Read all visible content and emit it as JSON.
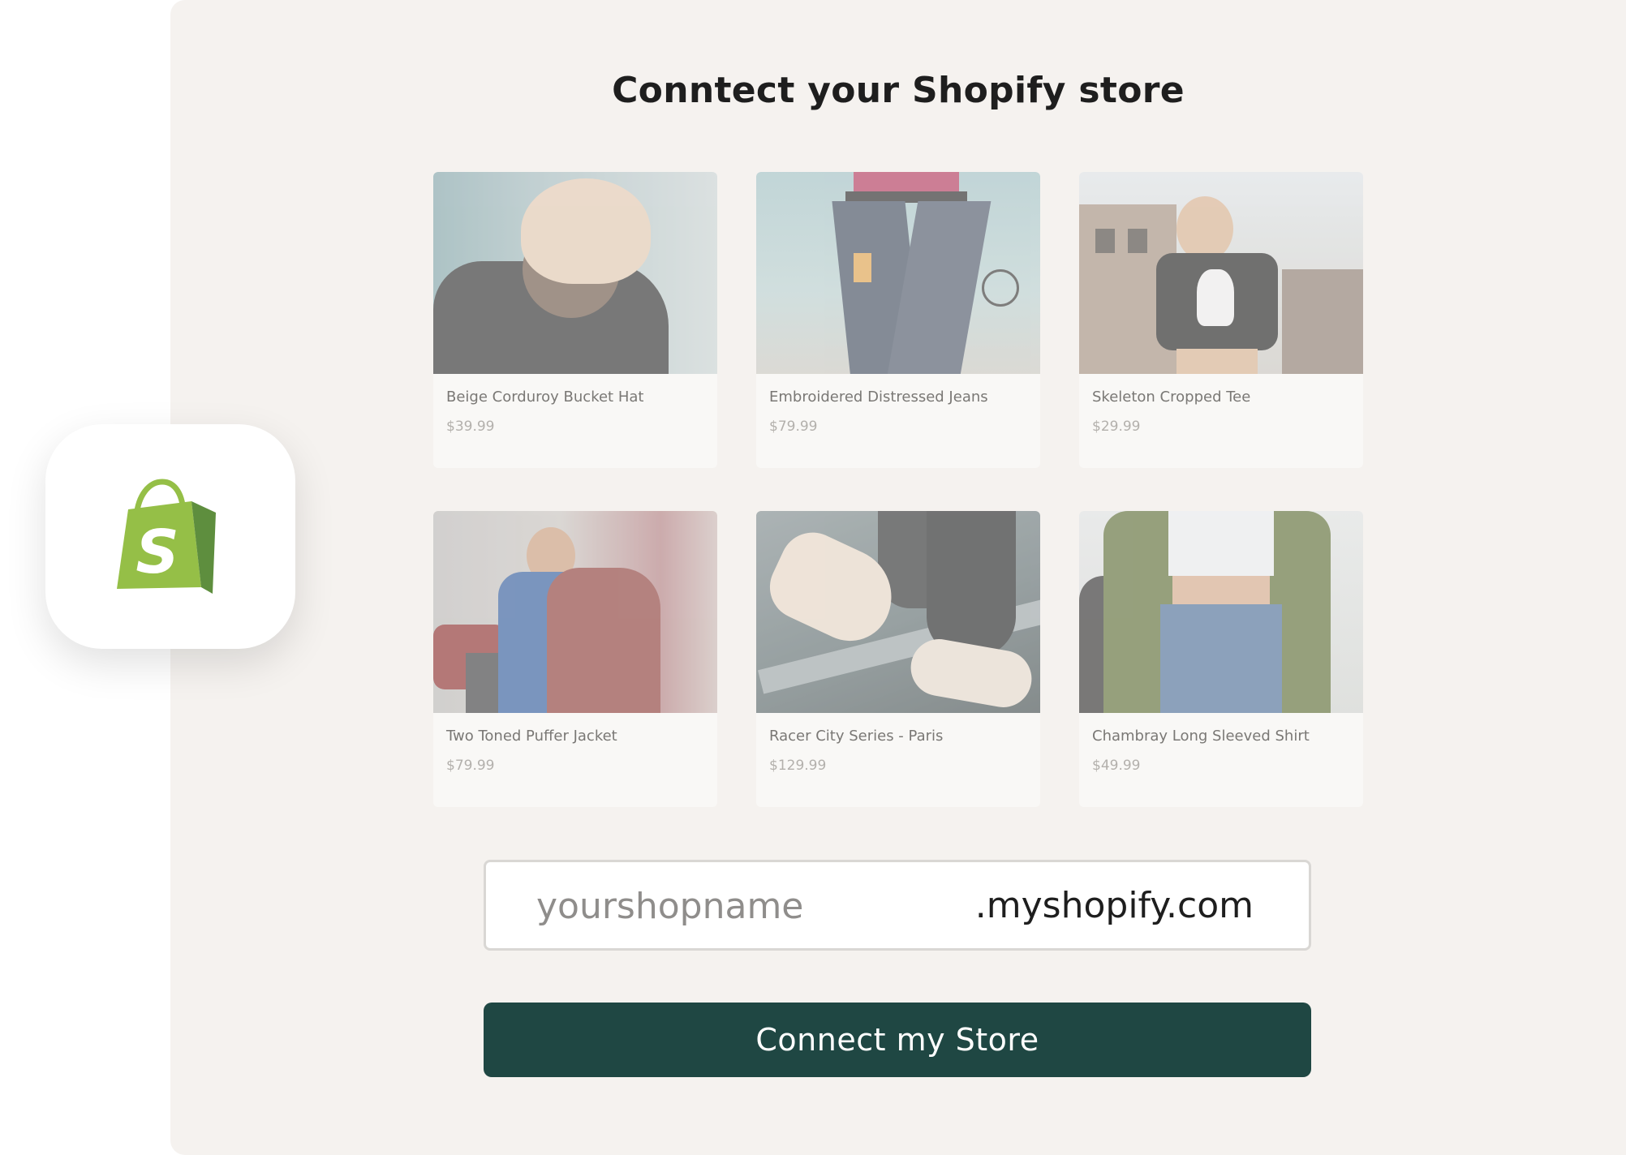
{
  "title": "Conntect your Shopify store",
  "logo": {
    "icon": "shopify-bag-icon",
    "letter": "S",
    "bag_color": "#95bf47",
    "bag_shade": "#5e8e3e"
  },
  "products": [
    {
      "name": "Beige Corduroy Bucket Hat",
      "price": "$39.99"
    },
    {
      "name": "Embroidered Distressed Jeans",
      "price": "$79.99"
    },
    {
      "name": "Skeleton Cropped Tee",
      "price": "$29.99"
    },
    {
      "name": "Two Toned Puffer Jacket",
      "price": "$79.99"
    },
    {
      "name": "Racer City Series - Paris",
      "price": "$129.99"
    },
    {
      "name": "Chambray Long Sleeved Shirt",
      "price": "$49.99"
    }
  ],
  "shop_field": {
    "value": "",
    "placeholder": "yourshopname",
    "suffix": ".myshopify.com"
  },
  "connect_button": {
    "label": "Connect my Store",
    "color": "#1f4743"
  }
}
